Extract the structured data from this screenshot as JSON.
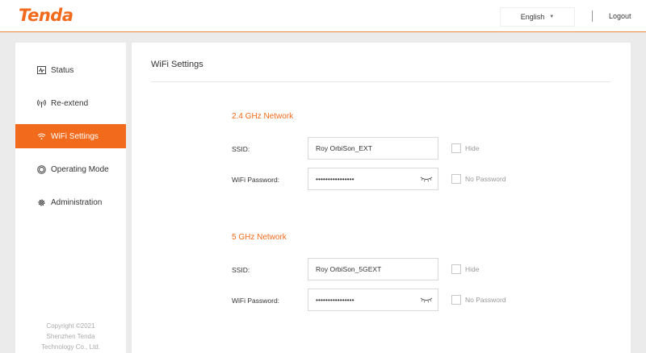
{
  "header": {
    "logo": "Tenda",
    "language": "English",
    "logout": "Logout"
  },
  "sidebar": {
    "items": [
      {
        "label": "Status",
        "icon": "status-icon"
      },
      {
        "label": "Re-extend",
        "icon": "re-extend-icon"
      },
      {
        "label": "WiFi Settings",
        "icon": "wifi-icon",
        "active": true
      },
      {
        "label": "Operating Mode",
        "icon": "operating-mode-icon"
      },
      {
        "label": "Administration",
        "icon": "gear-icon"
      }
    ],
    "copyright": [
      "Copyright ©2021",
      "Shenzhen Tenda",
      "Technology Co., Ltd."
    ]
  },
  "main": {
    "title": "WiFi Settings",
    "networks": [
      {
        "title": "2.4 GHz Network",
        "ssid_label": "SSID:",
        "ssid_value": "Roy OrbiSon_EXT",
        "hide_label": "Hide",
        "password_label": "WiFi Password:",
        "password_value": "••••••••••••••••",
        "no_password_label": "No Password"
      },
      {
        "title": "5 GHz Network",
        "ssid_label": "SSID:",
        "ssid_value": "Roy OrbiSon_5GEXT",
        "hide_label": "Hide",
        "password_label": "WiFi Password:",
        "password_value": "••••••••••••••••",
        "no_password_label": "No Password"
      }
    ]
  },
  "colors": {
    "accent": "#f26a1b",
    "background": "#ebebeb"
  }
}
